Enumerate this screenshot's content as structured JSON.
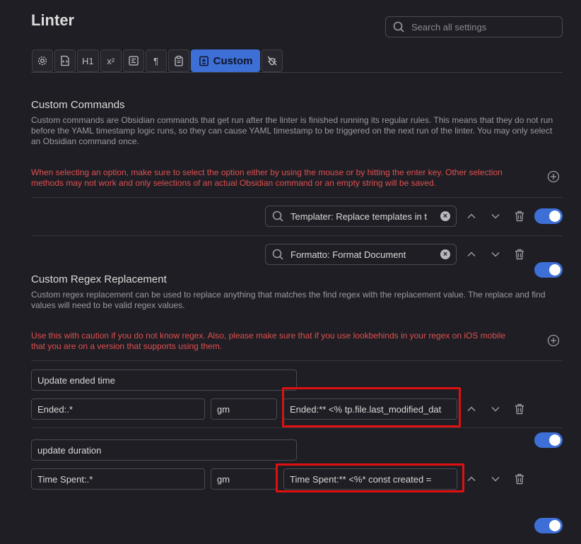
{
  "header": {
    "title": "Linter",
    "search_placeholder": "Search all settings"
  },
  "tabs": [
    {
      "icon": "gear-icon"
    },
    {
      "icon": "file-code-icon"
    },
    {
      "icon": "heading-icon",
      "label": "H1"
    },
    {
      "icon": "superscript-icon",
      "label": "x²"
    },
    {
      "icon": "align-icon"
    },
    {
      "icon": "pilcrow-icon",
      "label": "¶"
    },
    {
      "icon": "clipboard-icon"
    },
    {
      "icon": "custom-icon",
      "label": "Custom",
      "active": true
    },
    {
      "icon": "bug-icon"
    }
  ],
  "custom_commands": {
    "heading": "Custom Commands",
    "description": "Custom commands are Obsidian commands that get run after the linter is finished running its regular rules. This means that they do not run before the YAML timestamp logic runs, so they can cause YAML timestamp to be triggered on the next run of the linter. You may only select an Obsidian command once.",
    "warning": "When selecting an option, make sure to select the option either by using the mouse or by hitting the enter key. Other selection methods may not work and only selections of an actual Obsidian command or an empty string will be saved.",
    "commands": [
      {
        "value": "Templater: Replace templates in t",
        "enabled": true
      },
      {
        "value": "Formatto: Format Document",
        "enabled": true
      }
    ]
  },
  "custom_regex": {
    "heading": "Custom Regex Replacement",
    "description": "Custom regex replacement can be used to replace anything that matches the find regex with the replacement value. The replace and find values will need to be valid regex values.",
    "warning": "Use this with caution if you do not know regex. Also, please make sure that if you use lookbehinds in your regex on iOS mobile that you are on a version that supports using them.",
    "rules": [
      {
        "label": "Update ended time",
        "find": "Ended:.*",
        "flags": "gm",
        "replace": "Ended:** <% tp.file.last_modified_dat",
        "enabled": true
      },
      {
        "label": "update duration",
        "find": "Time Spent:.*",
        "flags": "gm",
        "replace": "Time Spent:** <%*   const created =",
        "enabled": true
      }
    ]
  },
  "colors": {
    "accent": "#3d6fd6",
    "warning": "#e05050",
    "highlight": "#e01010"
  }
}
